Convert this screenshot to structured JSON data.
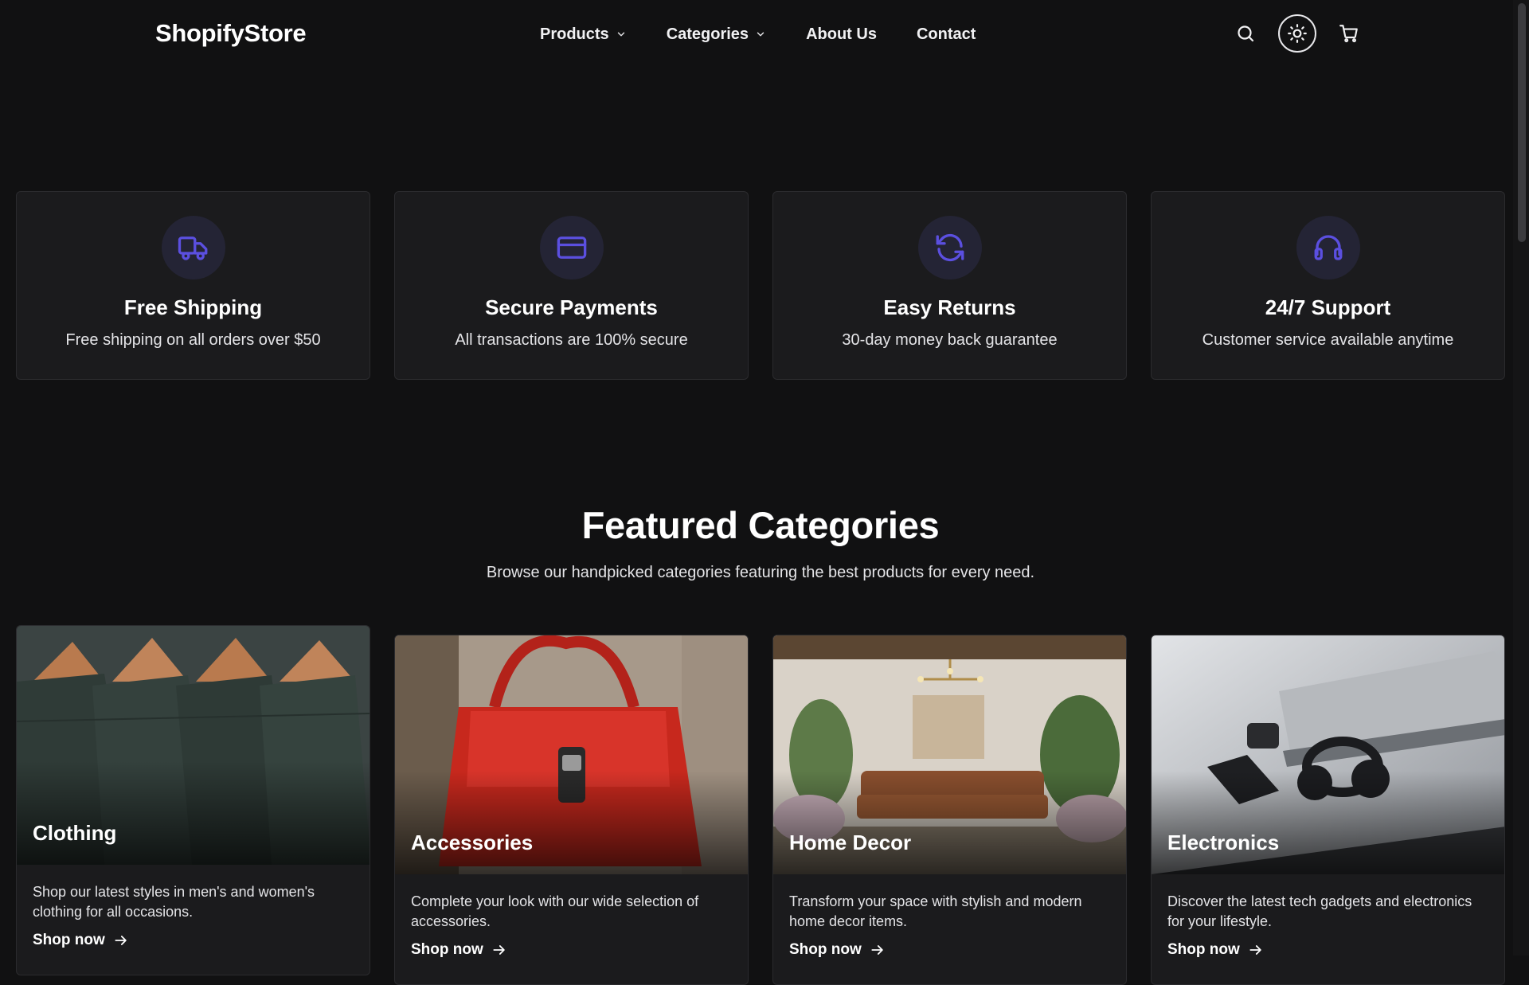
{
  "brand": {
    "name": "ShopifyStore"
  },
  "nav": {
    "items": [
      {
        "label": "Products",
        "has_dropdown": true
      },
      {
        "label": "Categories",
        "has_dropdown": true
      },
      {
        "label": "About Us",
        "has_dropdown": false
      },
      {
        "label": "Contact",
        "has_dropdown": false
      }
    ]
  },
  "header_icons": [
    "search-icon",
    "sun-icon",
    "cart-icon"
  ],
  "features": [
    {
      "icon": "truck-icon",
      "title": "Free Shipping",
      "description": "Free shipping on all orders over $50"
    },
    {
      "icon": "credit-card-icon",
      "title": "Secure Payments",
      "description": "All transactions are 100% secure"
    },
    {
      "icon": "refresh-icon",
      "title": "Easy Returns",
      "description": "30-day money back guarantee"
    },
    {
      "icon": "headphones-icon",
      "title": "24/7 Support",
      "description": "Customer service available anytime"
    }
  ],
  "featured": {
    "title": "Featured Categories",
    "subtitle": "Browse our handpicked categories featuring the best products for every need."
  },
  "categories": [
    {
      "name": "Clothing",
      "description": "Shop our latest styles in men's and women's clothing for all occasions.",
      "link": "Shop now"
    },
    {
      "name": "Accessories",
      "description": "Complete your look with our wide selection of accessories.",
      "link": "Shop now"
    },
    {
      "name": "Home Decor",
      "description": "Transform your space with stylish and modern home decor items.",
      "link": "Shop now"
    },
    {
      "name": "Electronics",
      "description": "Discover the latest tech gadgets and electronics for your lifestyle.",
      "link": "Shop now"
    }
  ],
  "colors": {
    "background": "#111112",
    "card": "#1b1b1d",
    "accent": "#5b4fe0",
    "icon_circle": "#242435",
    "text": "#ffffff"
  }
}
